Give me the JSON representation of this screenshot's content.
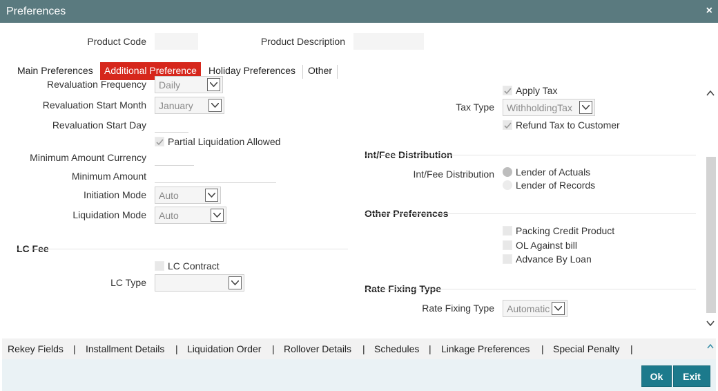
{
  "window": {
    "title": "Preferences",
    "close_icon": "×"
  },
  "header": {
    "product_code_label": "Product Code",
    "product_code_value": "",
    "product_description_label": "Product Description",
    "product_description_value": ""
  },
  "tabs": [
    {
      "label": "Main Preferences",
      "active": false
    },
    {
      "label": "Additional Preference",
      "active": true
    },
    {
      "label": "Holiday Preferences",
      "active": false
    },
    {
      "label": "Other",
      "active": false
    }
  ],
  "left": {
    "revaluation_frequency_label": "Revaluation Frequency",
    "revaluation_frequency_value": "Daily",
    "revaluation_start_month_label": "Revaluation Start Month",
    "revaluation_start_month_value": "January",
    "revaluation_start_day_label": "Revaluation Start Day",
    "revaluation_start_day_value": "",
    "partial_liquidation_label": "Partial Liquidation Allowed",
    "partial_liquidation_checked": true,
    "minimum_amount_currency_label": "Minimum Amount Currency",
    "minimum_amount_currency_value": "",
    "minimum_amount_label": "Minimum Amount",
    "minimum_amount_value": "",
    "initiation_mode_label": "Initiation Mode",
    "initiation_mode_value": "Auto",
    "liquidation_mode_label": "Liquidation Mode",
    "liquidation_mode_value": "Auto"
  },
  "lc_fee": {
    "title": "LC Fee",
    "lc_contract_label": "LC Contract",
    "lc_contract_checked": false,
    "lc_type_label": "LC Type",
    "lc_type_value": ""
  },
  "tax": {
    "apply_tax_label": "Apply Tax",
    "apply_tax_checked": true,
    "tax_type_label": "Tax Type",
    "tax_type_value": "WithholdingTax",
    "refund_tax_label": "Refund Tax to Customer",
    "refund_tax_checked": true
  },
  "int_fee": {
    "title": "Int/Fee Distribution",
    "label": "Int/Fee Distribution",
    "options": [
      {
        "label": "Lender of Actuals",
        "selected": true
      },
      {
        "label": "Lender of Records",
        "selected": false
      }
    ]
  },
  "other_preferences": {
    "title": "Other Preferences",
    "packing_credit_label": "Packing Credit Product",
    "ol_against_bill_label": "OL Against bill",
    "advance_by_loan_label": "Advance By Loan"
  },
  "rate_fixing": {
    "title": "Rate Fixing Type",
    "label": "Rate Fixing Type",
    "value": "Automatic"
  },
  "footer_links": [
    "Rekey Fields",
    "Installment Details",
    "Liquidation Order",
    "Rollover Details",
    "Schedules",
    "Linkage Preferences",
    "Special Penalty"
  ],
  "footer_separator": "|",
  "buttons": {
    "ok": "Ok",
    "exit": "Exit"
  },
  "colors": {
    "titlebar": "#5a7a7f",
    "active_tab": "#d6271c",
    "button": "#1c7a8c"
  }
}
